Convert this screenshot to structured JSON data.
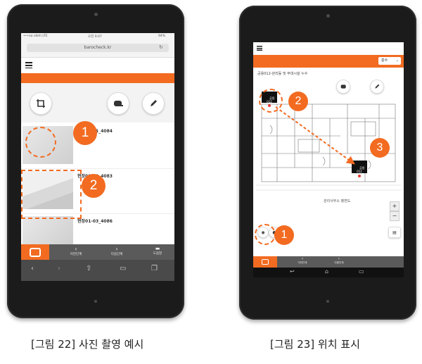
{
  "left_device": {
    "status": {
      "carrier": "•••oo olleh  LTE",
      "time": "오전 9:07",
      "battery": "94%"
    },
    "url": "barocheck.kr",
    "list_items": [
      {
        "label": "현장01-01_4084"
      },
      {
        "label": "현장01-02_4083"
      },
      {
        "label": "현장01-03_4086"
      }
    ],
    "bottom_nav": {
      "prev": "이전단계",
      "next": "다음단계",
      "menu": "도움말"
    },
    "markers": [
      "1",
      "2"
    ]
  },
  "right_device": {
    "dropdown_value": "층수",
    "plan_title": "공용012-관리동 및 부대시설 누수",
    "pin_label": "공용\n012",
    "plan_room_label": "관리사무소 평면도",
    "bottom_nav": {
      "prev": "이전단계",
      "next": "다음단계"
    },
    "markers": [
      "1",
      "2",
      "3"
    ]
  },
  "captions": {
    "left": "[그림 22] 사진 촬영 예시",
    "right": "[그림 23] 위치 표시"
  },
  "colors": {
    "accent": "#f26b21",
    "device": "#1b1b1b"
  }
}
